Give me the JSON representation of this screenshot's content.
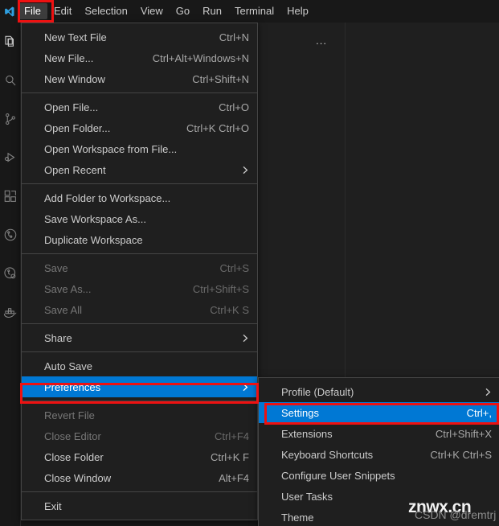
{
  "window": {
    "background": "#1e1e1e",
    "accent": "#0078d4",
    "annotation_color": "#ee1111"
  },
  "titlebar": {
    "logo_name": "vscode-logo",
    "menus": [
      {
        "label": "File",
        "active": true
      },
      {
        "label": "Edit",
        "active": false
      },
      {
        "label": "Selection",
        "active": false
      },
      {
        "label": "View",
        "active": false
      },
      {
        "label": "Go",
        "active": false
      },
      {
        "label": "Run",
        "active": false
      },
      {
        "label": "Terminal",
        "active": false
      },
      {
        "label": "Help",
        "active": false
      }
    ]
  },
  "activitybar": {
    "items": [
      {
        "icon": "files-explorer-icon",
        "active": true
      },
      {
        "icon": "search-icon",
        "active": false
      },
      {
        "icon": "source-control-icon",
        "active": false
      },
      {
        "icon": "run-and-debug-icon",
        "active": false
      },
      {
        "icon": "extensions-icon",
        "active": false
      },
      {
        "icon": "testing-beaker-icon",
        "active": false
      },
      {
        "icon": "remote-explorer-icon",
        "active": false
      },
      {
        "icon": "docker-icon",
        "active": false
      }
    ]
  },
  "sidebar": {
    "overflow_label": "...",
    "overflow_icon": "more-actions-icon"
  },
  "file_menu": {
    "groups": [
      {
        "items": [
          {
            "label": "New Text File",
            "keybinding": "Ctrl+N",
            "disabled": false,
            "submenu": false,
            "selected": false
          },
          {
            "label": "New File...",
            "keybinding": "Ctrl+Alt+Windows+N",
            "disabled": false,
            "submenu": false,
            "selected": false
          },
          {
            "label": "New Window",
            "keybinding": "Ctrl+Shift+N",
            "disabled": false,
            "submenu": false,
            "selected": false
          }
        ]
      },
      {
        "items": [
          {
            "label": "Open File...",
            "keybinding": "Ctrl+O",
            "disabled": false,
            "submenu": false,
            "selected": false
          },
          {
            "label": "Open Folder...",
            "keybinding": "Ctrl+K Ctrl+O",
            "disabled": false,
            "submenu": false,
            "selected": false
          },
          {
            "label": "Open Workspace from File...",
            "keybinding": "",
            "disabled": false,
            "submenu": false,
            "selected": false
          },
          {
            "label": "Open Recent",
            "keybinding": "",
            "disabled": false,
            "submenu": true,
            "selected": false
          }
        ]
      },
      {
        "items": [
          {
            "label": "Add Folder to Workspace...",
            "keybinding": "",
            "disabled": false,
            "submenu": false,
            "selected": false
          },
          {
            "label": "Save Workspace As...",
            "keybinding": "",
            "disabled": false,
            "submenu": false,
            "selected": false
          },
          {
            "label": "Duplicate Workspace",
            "keybinding": "",
            "disabled": false,
            "submenu": false,
            "selected": false
          }
        ]
      },
      {
        "items": [
          {
            "label": "Save",
            "keybinding": "Ctrl+S",
            "disabled": true,
            "submenu": false,
            "selected": false
          },
          {
            "label": "Save As...",
            "keybinding": "Ctrl+Shift+S",
            "disabled": true,
            "submenu": false,
            "selected": false
          },
          {
            "label": "Save All",
            "keybinding": "Ctrl+K S",
            "disabled": true,
            "submenu": false,
            "selected": false
          }
        ]
      },
      {
        "items": [
          {
            "label": "Share",
            "keybinding": "",
            "disabled": false,
            "submenu": true,
            "selected": false
          }
        ]
      },
      {
        "items": [
          {
            "label": "Auto Save",
            "keybinding": "",
            "disabled": false,
            "submenu": false,
            "selected": false
          },
          {
            "label": "Preferences",
            "keybinding": "",
            "disabled": false,
            "submenu": true,
            "selected": true
          }
        ]
      },
      {
        "items": [
          {
            "label": "Revert File",
            "keybinding": "",
            "disabled": true,
            "submenu": false,
            "selected": false
          },
          {
            "label": "Close Editor",
            "keybinding": "Ctrl+F4",
            "disabled": true,
            "submenu": false,
            "selected": false
          },
          {
            "label": "Close Folder",
            "keybinding": "Ctrl+K F",
            "disabled": false,
            "submenu": false,
            "selected": false
          },
          {
            "label": "Close Window",
            "keybinding": "Alt+F4",
            "disabled": false,
            "submenu": false,
            "selected": false
          }
        ]
      },
      {
        "items": [
          {
            "label": "Exit",
            "keybinding": "",
            "disabled": false,
            "submenu": false,
            "selected": false
          }
        ]
      }
    ]
  },
  "preferences_menu": {
    "groups": [
      {
        "items": [
          {
            "label": "Profile (Default)",
            "keybinding": "",
            "disabled": false,
            "submenu": true,
            "selected": false
          },
          {
            "label": "Settings",
            "keybinding": "Ctrl+,",
            "disabled": false,
            "submenu": false,
            "selected": true
          },
          {
            "label": "Extensions",
            "keybinding": "Ctrl+Shift+X",
            "disabled": false,
            "submenu": false,
            "selected": false
          },
          {
            "label": "Keyboard Shortcuts",
            "keybinding": "Ctrl+K Ctrl+S",
            "disabled": false,
            "submenu": false,
            "selected": false
          },
          {
            "label": "Configure User Snippets",
            "keybinding": "",
            "disabled": false,
            "submenu": false,
            "selected": false
          },
          {
            "label": "User Tasks",
            "keybinding": "",
            "disabled": false,
            "submenu": false,
            "selected": false
          },
          {
            "label": "Theme",
            "keybinding": "",
            "disabled": false,
            "submenu": false,
            "selected": false
          }
        ]
      }
    ]
  },
  "watermark": {
    "primary": "znwx.cn",
    "secondary": "CSDN @dremtrj"
  }
}
